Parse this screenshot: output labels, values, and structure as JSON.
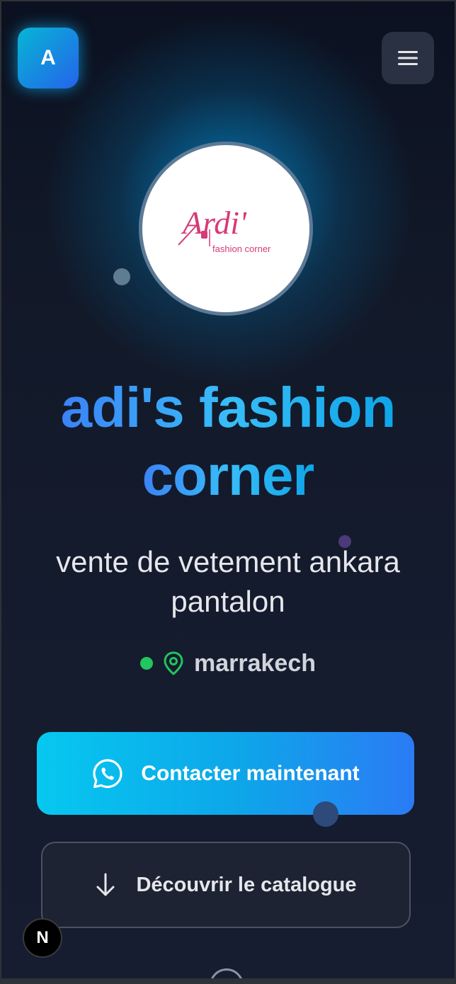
{
  "header": {
    "brand_initial": "A",
    "menu_icon": "hamburger-menu-icon"
  },
  "hero": {
    "logo_text_main": "Ardi'",
    "logo_text_sub": "fashion corner",
    "title": "adi's fashion corner",
    "title_line1": "adi's fashion",
    "title_line2": "corner",
    "subtitle": "vente de vetement ankara pantalon",
    "location": "marrakech",
    "status_color": "#22c55e",
    "accent": "#0ea5e9"
  },
  "actions": {
    "contact_label": "Contacter maintenant",
    "contact_icon": "whatsapp-icon",
    "catalog_label": "Découvrir le catalogue",
    "catalog_icon": "arrow-down-icon"
  },
  "devtools": {
    "badge_label": "N"
  }
}
